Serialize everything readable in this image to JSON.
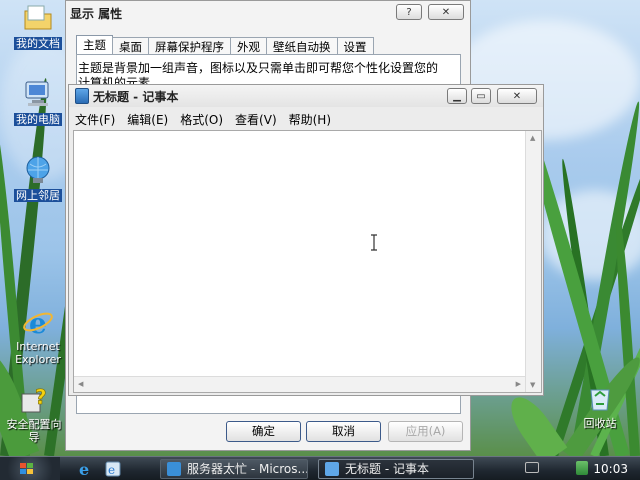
{
  "desktop_icons": [
    {
      "name": "desktop-icon-my-documents",
      "label": "我的文档"
    },
    {
      "name": "desktop-icon-my-computer",
      "label": "我的电脑"
    },
    {
      "name": "desktop-icon-network",
      "label": "网上邻居"
    },
    {
      "name": "desktop-icon-ie",
      "label": "Internet Explorer"
    },
    {
      "name": "desktop-icon-security-wizard",
      "label": "安全配置向导"
    },
    {
      "name": "desktop-icon-recycle-bin",
      "label": "回收站"
    }
  ],
  "display_properties": {
    "title": "显示 属性",
    "help_icon": "?",
    "close_icon": "✕",
    "tabs": [
      "主题",
      "桌面",
      "屏幕保护程序",
      "外观",
      "壁纸自动换",
      "设置"
    ],
    "active_tab": "主题",
    "description": "主题是背景加一组声音，图标以及只需单击即可帮您个性化设置您的计算机的元素。",
    "buttons": {
      "ok": "确定",
      "cancel": "取消",
      "apply": "应用(A)"
    }
  },
  "notepad": {
    "title": "无标题 - 记事本",
    "menus": [
      "文件(F)",
      "编辑(E)",
      "格式(O)",
      "查看(V)",
      "帮助(H)"
    ],
    "content": ""
  },
  "taskbar": {
    "tasks": [
      {
        "label": "服务器太忙 - Micros...",
        "active": false
      },
      {
        "label": "无标题 - 记事本",
        "active": true
      }
    ],
    "clock": "10:03"
  }
}
